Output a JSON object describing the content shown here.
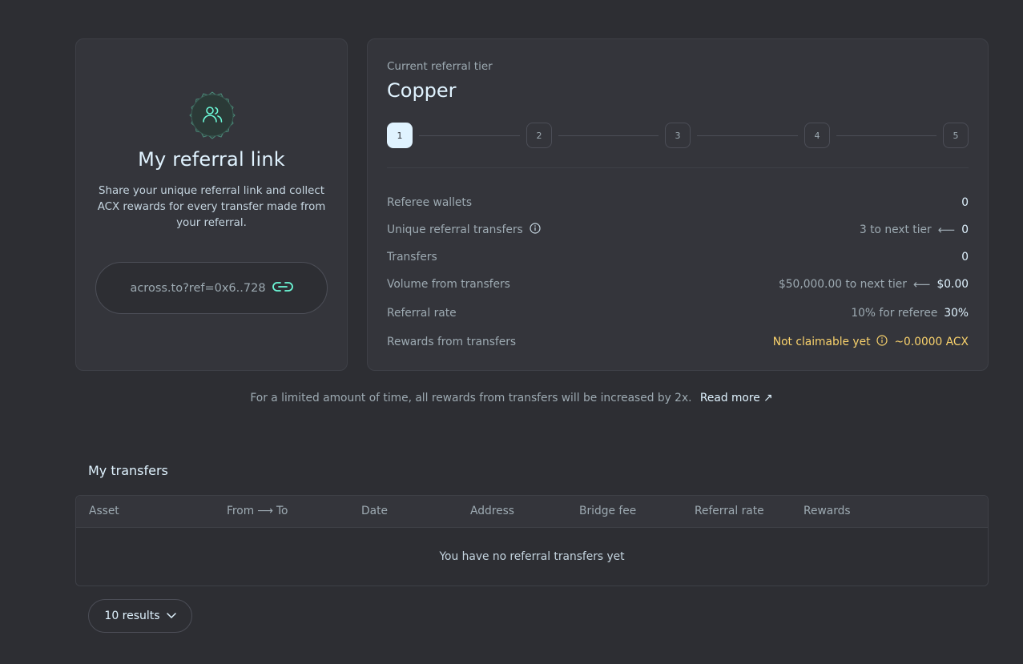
{
  "referral_link_card": {
    "title": "My referral link",
    "description": "Share your unique referral link and collect ACX rewards for every transfer made from your referral.",
    "link": "across.to?ref=0x6..728",
    "icons": {
      "badge": "users-icon",
      "copy": "link-icon"
    }
  },
  "tier_card": {
    "label": "Current referral tier",
    "tier": "Copper",
    "steps": [
      "1",
      "2",
      "3",
      "4",
      "5"
    ],
    "active_step": 1,
    "stats": {
      "referee_wallets": {
        "label": "Referee wallets",
        "value": "0"
      },
      "unique_transfers": {
        "label": "Unique referral transfers",
        "sub": "3 to next tier",
        "value": "0"
      },
      "transfers": {
        "label": "Transfers",
        "value": "0"
      },
      "volume": {
        "label": "Volume from transfers",
        "sub": "$50,000.00 to next tier",
        "value": "$0.00"
      },
      "referral_rate": {
        "label": "Referral rate",
        "sub": "10% for referee",
        "value": "30%"
      },
      "rewards": {
        "label": "Rewards from transfers",
        "sub": "Not claimable yet",
        "value": "~0.0000 ACX"
      }
    }
  },
  "promo": {
    "text": "For a limited amount of time, all rewards from transfers will be increased by 2x.",
    "link": "Read more"
  },
  "transfers": {
    "title": "My transfers",
    "columns": {
      "asset": "Asset",
      "from": "From",
      "to": "To",
      "date": "Date",
      "address": "Address",
      "bridge_fee": "Bridge fee",
      "referral_rate": "Referral rate",
      "rewards": "Rewards"
    },
    "empty_text": "You have no referral transfers yet",
    "page_size": "10 results"
  },
  "colors": {
    "background": "#2d2e33",
    "card": "#34353b",
    "text": "#e0f3ff",
    "muted": "#9daab2",
    "accent": "#6cf9d8",
    "warning": "#f9d26c"
  }
}
